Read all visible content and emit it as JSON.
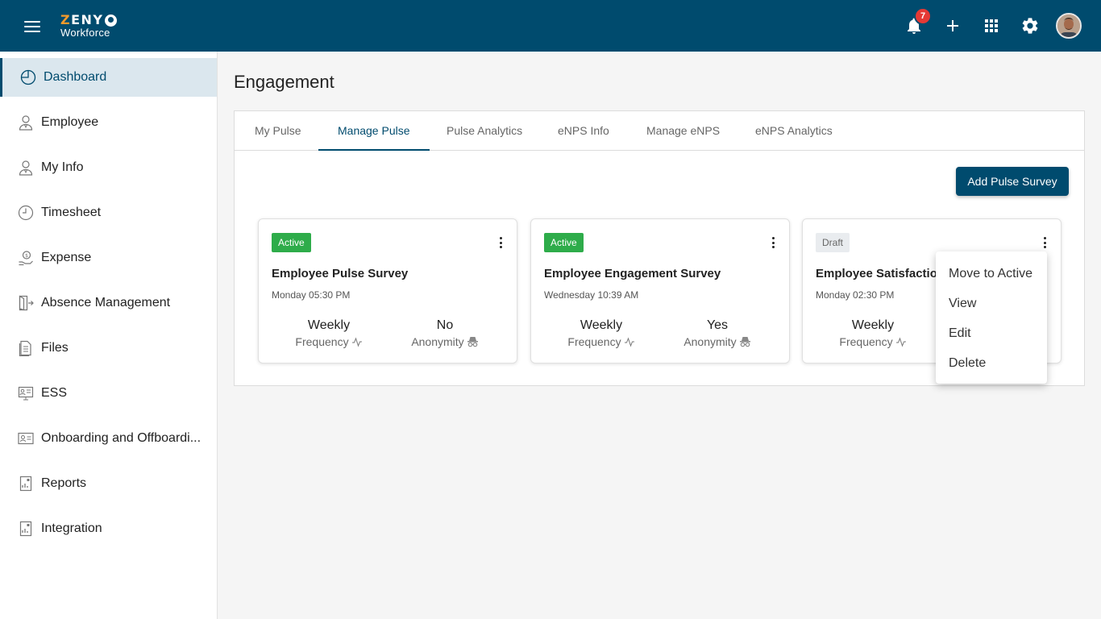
{
  "header": {
    "logo_top": "ZENY",
    "logo_bottom": "Workforce",
    "notification_count": "7",
    "icons": [
      "menu-icon",
      "bell-icon",
      "plus-icon",
      "apps-grid-icon",
      "gear-icon",
      "avatar"
    ],
    "accent_color": "#004b6e"
  },
  "sidebar": {
    "items": [
      {
        "label": "Dashboard",
        "icon": "pie-chart-icon",
        "active": true
      },
      {
        "label": "Employee",
        "icon": "user-icon"
      },
      {
        "label": "My Info",
        "icon": "user-icon"
      },
      {
        "label": "Timesheet",
        "icon": "clock-icon"
      },
      {
        "label": "Expense",
        "icon": "money-hand-icon"
      },
      {
        "label": "Absence Management",
        "icon": "exit-door-icon"
      },
      {
        "label": "Files",
        "icon": "file-icon"
      },
      {
        "label": "ESS",
        "icon": "monitor-user-icon"
      },
      {
        "label": "Onboarding and Offboardi...",
        "icon": "id-card-icon"
      },
      {
        "label": "Reports",
        "icon": "report-icon"
      },
      {
        "label": "Integration",
        "icon": "report-icon"
      }
    ]
  },
  "page": {
    "title": "Engagement",
    "tabs": [
      {
        "label": "My Pulse"
      },
      {
        "label": "Manage Pulse",
        "active": true
      },
      {
        "label": "Pulse Analytics"
      },
      {
        "label": "eNPS Info"
      },
      {
        "label": "Manage eNPS"
      },
      {
        "label": "eNPS Analytics"
      }
    ],
    "add_button": "Add Pulse Survey",
    "cards": [
      {
        "status": "Active",
        "title": "Employee Pulse Survey",
        "date": "Monday  05:30 PM",
        "frequency_value": "Weekly",
        "frequency_label": "Frequency",
        "anonymity_value": "No",
        "anonymity_label": "Anonymity"
      },
      {
        "status": "Active",
        "title": "Employee Engagement Survey",
        "date": "Wednesday  10:39 AM",
        "frequency_value": "Weekly",
        "frequency_label": "Frequency",
        "anonymity_value": "Yes",
        "anonymity_label": "Anonymity"
      },
      {
        "status": "Draft",
        "title": "Employee Satisfaction",
        "date": "Monday  02:30 PM",
        "frequency_value": "Weekly",
        "frequency_label": "Frequency"
      }
    ],
    "context_menu": [
      "Move to Active",
      "View",
      "Edit",
      "Delete"
    ]
  }
}
